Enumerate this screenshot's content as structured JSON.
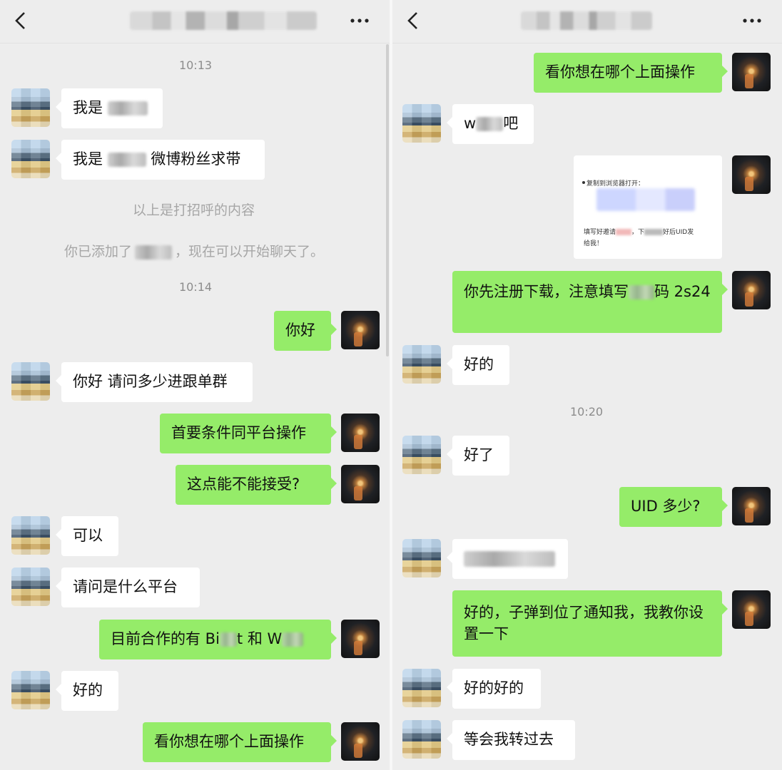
{
  "left_chat": {
    "times": [
      "10:13",
      "10:14"
    ],
    "system": [
      "以上是打招呼的内容",
      "你已添加了",
      "，现在可以开始聊天了。"
    ],
    "messages": {
      "m1_text": "我是",
      "m2_text": "我是",
      "m2_suffix": "微博粉丝求带",
      "m3": "你好",
      "m4": "你好 请问多少进跟单群",
      "m5": "首要条件同平台操作",
      "m6": "这点能不能接受?",
      "m7": "可以",
      "m8": "请问是什么平台",
      "m9_a": "目前合作的有 Bi",
      "m9_b": "t 和 W",
      "m10": "好的",
      "m11": "看你想在哪个上面操作"
    }
  },
  "right_chat": {
    "time": "10:20",
    "messages": {
      "m1": "看你想在哪个上面操作",
      "m2_a": "w",
      "m2_b": "吧",
      "card_line1": "复制到浏览器打开：",
      "card_line2": "填写好邀请",
      "card_line2b": "，下",
      "card_line2c": "好后UID发",
      "card_line3": "给我！",
      "m4_a": "你先注册下载，注意填写",
      "m4_b": "码 2s24",
      "m5": "好的",
      "m6": "好了",
      "m7": "UID 多少?",
      "m9": "好的，子弹到位了通知我，我教你设置一下",
      "m10": "好的好的",
      "m11": "等会我转过去"
    }
  },
  "icons": [
    "chevron-left-icon",
    "more-dots-icon"
  ]
}
